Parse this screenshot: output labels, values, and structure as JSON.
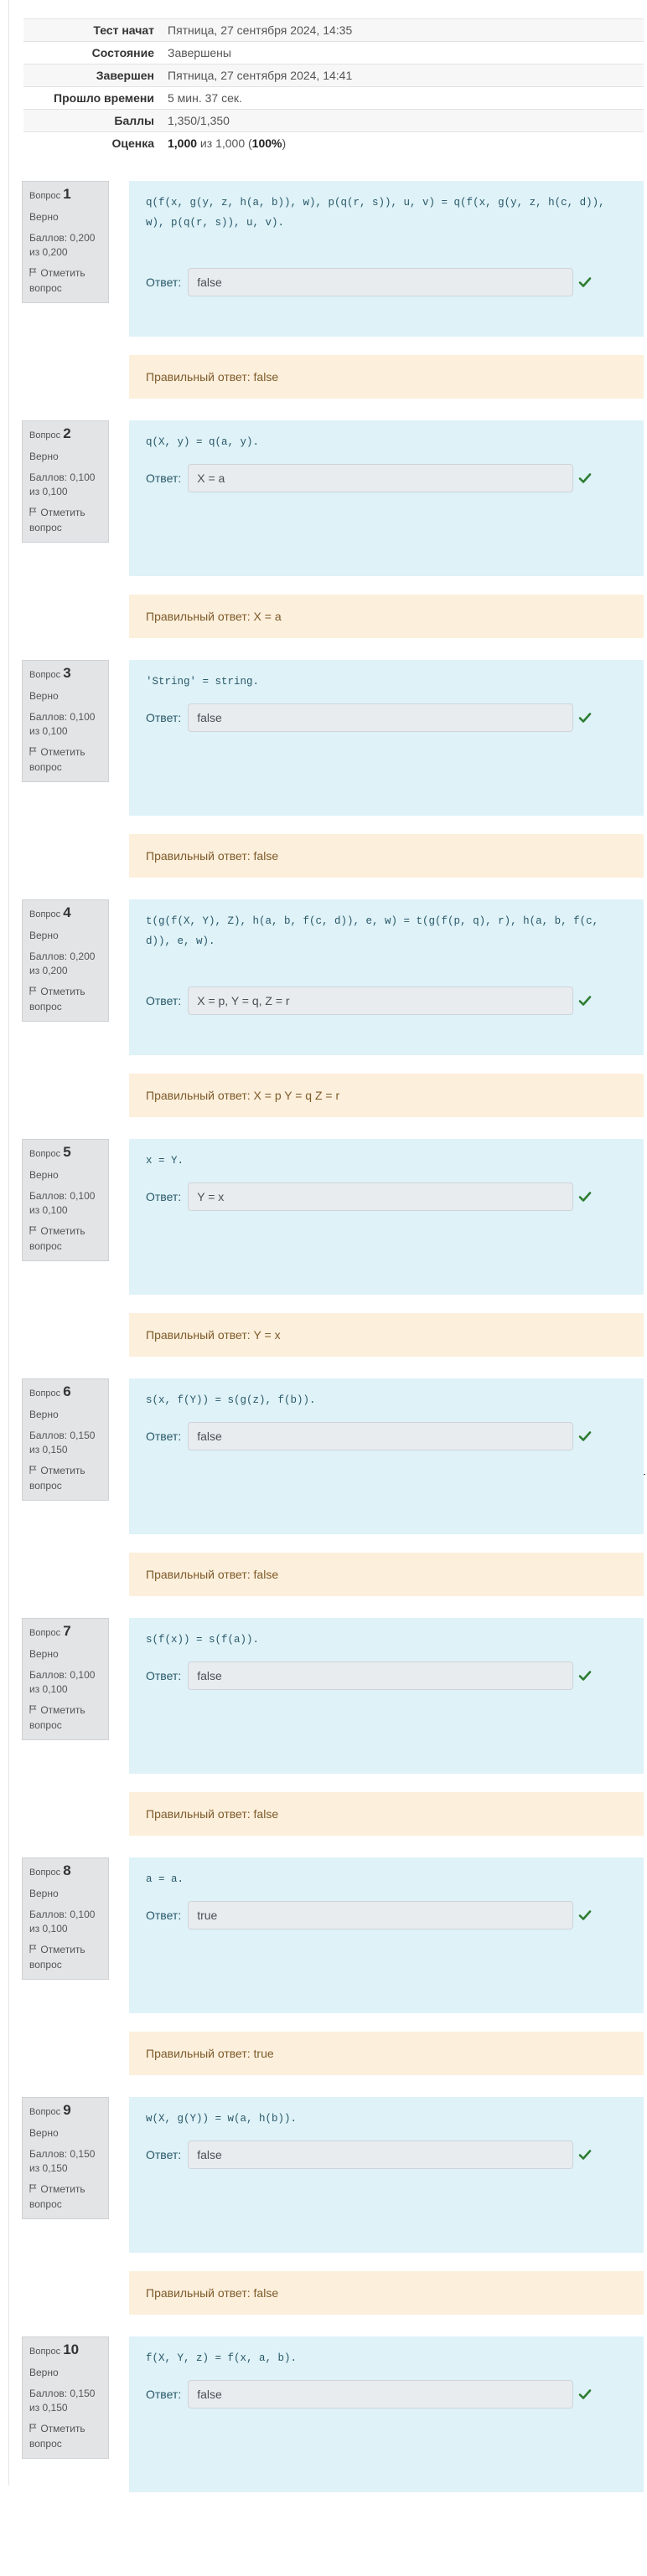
{
  "summary": [
    {
      "key": "Тест начат",
      "value": "Пятница, 27 сентября 2024, 14:35"
    },
    {
      "key": "Состояние",
      "value": "Завершены"
    },
    {
      "key": "Завершен",
      "value": "Пятница, 27 сентября 2024, 14:41"
    },
    {
      "key": "Прошло времени",
      "value": "5 мин. 37 сек."
    },
    {
      "key": "Баллы",
      "value": "1,350/1,350"
    },
    {
      "key": "Оценка",
      "value_bold": "1,000",
      "value_mid": " из 1,000 (",
      "value_pct": "100%",
      "value_end": ")"
    }
  ],
  "labels": {
    "question": "Вопрос",
    "answer": "Ответ:",
    "flag": "Отметить вопрос",
    "correct_prefix": "Правильный ответ: "
  },
  "questions": [
    {
      "num": "1",
      "state": "Верно",
      "grade": "Баллов: 0,200 из 0,200",
      "text": "q(f(x, g(y, z, h(a, b)), w), p(q(r, s)), u, v) = q(f(x, g(y, z, h(c, d)), w), p(q(r, s)), u, v).",
      "answer": "false",
      "feedback": "Правильный ответ: false"
    },
    {
      "num": "2",
      "state": "Верно",
      "grade": "Баллов: 0,100 из 0,100",
      "text": "q(X, y) = q(a, y).",
      "answer": "X = a",
      "feedback": "Правильный ответ: X = a"
    },
    {
      "num": "3",
      "state": "Верно",
      "grade": "Баллов: 0,100 из 0,100",
      "text": "'String' = string.",
      "answer": "false",
      "feedback": "Правильный ответ: false"
    },
    {
      "num": "4",
      "state": "Верно",
      "grade": "Баллов: 0,200 из 0,200",
      "text": "t(g(f(X, Y), Z), h(a, b, f(c, d)), e, w) = t(g(f(p, q), r), h(a, b, f(c, d)), e, w).",
      "answer": "X = p, Y = q, Z = r",
      "feedback": "Правильный ответ: X = p Y = q Z = r"
    },
    {
      "num": "5",
      "state": "Верно",
      "grade": "Баллов: 0,100 из 0,100",
      "text": "x = Y.",
      "answer": "Y = x",
      "feedback": "Правильный ответ: Y = x"
    },
    {
      "num": "6",
      "state": "Верно",
      "grade": "Баллов: 0,150 из 0,150",
      "text": "s(x, f(Y)) = s(g(z), f(b)).",
      "answer": "false",
      "feedback": "Правильный ответ: false"
    },
    {
      "num": "7",
      "state": "Верно",
      "grade": "Баллов: 0,100 из 0,100",
      "text": "s(f(x)) = s(f(a)).",
      "answer": "false",
      "feedback": "Правильный ответ: false"
    },
    {
      "num": "8",
      "state": "Верно",
      "grade": "Баллов: 0,100 из 0,100",
      "text": "a = a.",
      "answer": "true",
      "feedback": "Правильный ответ: true"
    },
    {
      "num": "9",
      "state": "Верно",
      "grade": "Баллов: 0,150 из 0,150",
      "text": "w(X, g(Y)) = w(a, h(b)).",
      "answer": "false",
      "feedback": "Правильный ответ: false"
    },
    {
      "num": "10",
      "state": "Верно",
      "grade": "Баллов: 0,150 из 0,150",
      "text": "f(X, Y, z) = f(x, a, b).",
      "answer": "false",
      "feedback": ""
    }
  ],
  "colors": {
    "info_bg": "#e3e4e6",
    "content_bg": "#def2f8",
    "feedback_bg": "#fcefdc",
    "check": "#2e7d32"
  },
  "icons": {
    "check": "check-icon",
    "flag": "flag-icon"
  }
}
